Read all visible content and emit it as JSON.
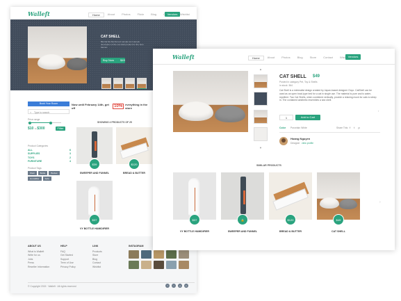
{
  "back": {
    "logo": "Walleft",
    "nav": [
      "Home",
      "About",
      "Photos",
      "Flickr",
      "Blog",
      "Contact",
      "Wishlist"
    ],
    "nav_button": "Vendors",
    "hero": {
      "title": "CAT SHELL",
      "desc": "Bla bla bla bla bla text sample text sample description of the cat shell product for the hero banner.",
      "buy_label": "Buy Now",
      "price": "$49"
    },
    "sidebar": {
      "button": "Book Your Room",
      "search_placeholder": "Type to search",
      "price_label": "Price range",
      "price_from": "$10",
      "price_to": "$300",
      "filter_button": "Filter",
      "categories_title": "Product Categories",
      "categories": [
        {
          "name": "ALL",
          "count": "6"
        },
        {
          "name": "SUPPLIES",
          "count": "3"
        },
        {
          "name": "TOYS",
          "count": "2"
        },
        {
          "name": "FURNITURE",
          "count": "4"
        }
      ],
      "tags_title": "Product Tags",
      "tags": [
        "Shell",
        "Bottle",
        "Bucket",
        "Humidifier",
        "Sofa"
      ]
    },
    "promo": {
      "text_before": "Now until February 14th, get off",
      "percent": "10%",
      "text_after": "everything in the store",
      "next_label": "Next week"
    },
    "showing": "SHOWING 4 PRODUCTS OF 25",
    "products": [
      {
        "name": "SWEEPER AND FUNNEL",
        "price": "$39"
      },
      {
        "name": "BREAD & BUTTER",
        "price": "$120"
      },
      {
        "name": "VY BOTTLE HUMIDIFIER",
        "price": "$37"
      }
    ],
    "footer": {
      "cols": [
        {
          "title": "ABOUT US",
          "items": [
            "What is Walleft",
            "Write for us",
            "Jobs",
            "Press",
            "Reseller Information"
          ]
        },
        {
          "title": "HELP",
          "items": [
            "FAQ",
            "Get Started",
            "Support",
            "Term of Use",
            "Privacy Policy"
          ]
        },
        {
          "title": "LINK",
          "items": [
            "Products",
            "Store",
            "Blog",
            "Contact",
            "Wishlist"
          ]
        }
      ],
      "instagram_title": "INSTAGRAM",
      "copyright": "© Copyright 2015 · Walleft · All rights reserved"
    }
  },
  "front": {
    "logo": "Walleft",
    "nav": [
      "Home",
      "About",
      "Photos",
      "Blog",
      "Store",
      "Contact",
      "Wishlist"
    ],
    "nav_button": "Vendors",
    "product": {
      "title": "CAT SHELL",
      "price": "$49",
      "meta": "Posted in category Pet, Toy & Shells",
      "meta2": "in stock: 364",
      "desc": "Cat Shell is a minimalist design created by Japan-based designer Ooyo. CatShell can be used as an open bowl-type bed for a cat in single use. The material is pure and is water-repellent. Two Cat Shells, when combined vertically, provide a relaxing mock for cats to sleep in. The contained aesthetic resembles a sea shell.",
      "qty": "1",
      "add_to_cart": "Add to Cart",
      "color_label": "Color",
      "color_value": "Porcelain White",
      "share_label": "Share This",
      "seller_name": "Hoang Nguyen",
      "seller_role": "Designer",
      "seller_link": "view profile"
    },
    "similar_title": "SIMILAR PRODUCTS",
    "similar": [
      {
        "name": "VY BOTTLE HUMIDIFIER",
        "price": "$37"
      },
      {
        "name": "SWEEPER AND FUNNEL",
        "price": ""
      },
      {
        "name": "BREAD & BUTTER",
        "price": "$120"
      },
      {
        "name": "CAT SHELL",
        "price": "$49"
      }
    ]
  },
  "colors": {
    "accent": "#2aa37e",
    "hero_bg": "#424d5c",
    "sale": "#e0443a"
  }
}
